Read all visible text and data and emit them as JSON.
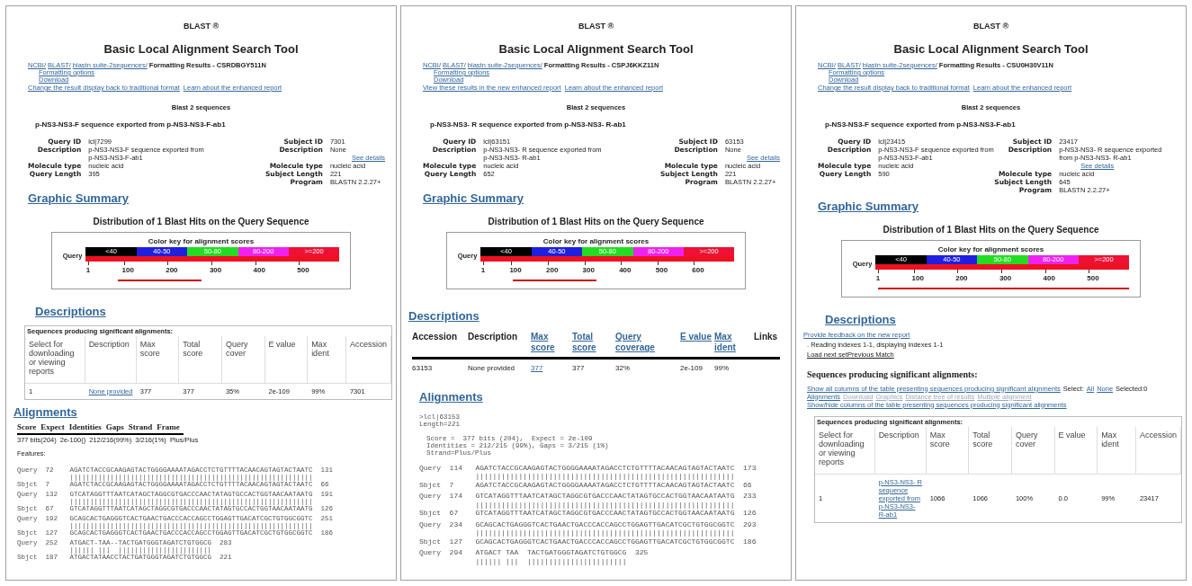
{
  "panels": [
    {
      "title": "BLAST ®",
      "subtitle": "Basic Local Alignment Search Tool",
      "breadcrumb": [
        "NCBI/",
        "BLAST/",
        "blastn suite-2sequences/"
      ],
      "results_label": "Formatting Results - CSRDBGY511N",
      "options": [
        "Formatting options",
        "Download"
      ],
      "report_links": [
        "Change the result display back to traditional format",
        "Learn about the enhanced report"
      ],
      "program_heading": "Blast 2 sequences",
      "query_title": "p-NS3-NS3-F sequence exported from p-NS3-NS3-F-ab1",
      "query_fields": [
        {
          "kind": "field",
          "label": "Query ID",
          "value": "lcl|7299"
        },
        {
          "kind": "field",
          "label": "Description",
          "value": "p-NS3-NS3-F sequence exported from p-NS3-NS3-F-ab1"
        },
        {
          "kind": "field",
          "label": "Molecule type",
          "value": "nucleic acid"
        },
        {
          "kind": "field",
          "label": "Query Length",
          "value": "395"
        }
      ],
      "subject_fields": [
        {
          "kind": "field",
          "label": "Subject ID",
          "value": "7301"
        },
        {
          "kind": "field",
          "label": "Description",
          "value": "None"
        },
        {
          "kind": "link",
          "value": "See details"
        },
        {
          "kind": "field",
          "label": "Molecule type",
          "value": "nucleic acid"
        },
        {
          "kind": "field",
          "label": "Subject Length",
          "value": "221"
        },
        {
          "kind": "field",
          "label": "Program",
          "value": "BLASTN 2.2.27+"
        }
      ],
      "graphic": {
        "heading": "Graphic Summary",
        "title": "Distribution of 1 Blast Hits on the Query Sequence",
        "key_title": "Color key for alignment scores",
        "query_label": "Query",
        "hit_full": false,
        "key": [
          {
            "label": "<40",
            "color": "#000000"
          },
          {
            "label": "40-50",
            "color": "#1f1fe0"
          },
          {
            "label": "50-80",
            "color": "#22dd22"
          },
          {
            "label": "80-200",
            "color": "#ee22ee"
          },
          {
            "label": ">=200",
            "color": "#ee1133"
          }
        ],
        "ticks": [
          "1",
          "100",
          "200",
          "300",
          "400",
          "500"
        ]
      },
      "descriptions": {
        "kind": "grid_table",
        "heading": "Descriptions",
        "caption": "Sequences producing significant alignments:",
        "columns": [
          "Select for downloading or viewing reports",
          "Description",
          "Max score",
          "Total score",
          "Query cover",
          "E value",
          "Max ident",
          "Accession"
        ],
        "rows": [
          [
            {
              "text": "1",
              "link": false
            },
            {
              "text": "None provided",
              "link": true
            },
            {
              "text": "377",
              "link": false
            },
            {
              "text": "377",
              "link": false
            },
            {
              "text": "35%",
              "link": false
            },
            {
              "text": "2e-109",
              "link": false
            },
            {
              "text": "99%",
              "link": false
            },
            {
              "text": "7301",
              "link": false
            }
          ]
        ]
      },
      "alignments": {
        "kind": "summary",
        "heading": "Alignments",
        "columns": [
          "Score",
          "Expect",
          "Identities",
          "Gaps",
          "Strand",
          "Frame"
        ],
        "values": [
          "377 bits(204)",
          "2e-100()",
          "212/216(99%)",
          "3/216(1%)",
          "Plus/Plus"
        ],
        "features": "Features:",
        "lines": [
          {
            "kind": "seq",
            "label": "Query",
            "start": "72",
            "seq": "AGATCTACCGCAAGAGTACTGGGGAAAATAGACCTCTGTTTTACAACAGTAGTACTAATC",
            "end": "131"
          },
          {
            "kind": "match",
            "seq": "||||||||||||||||||||||||||||||||||||||||||||||||||||||||||||"
          },
          {
            "kind": "seq",
            "label": "Sbjct",
            "start": "7",
            "seq": "AGATCTACCGCAAGAGTACTGGGGAAAATAGACCTCTGTTTTACAACAGTAGTACTAATC",
            "end": "66"
          },
          {
            "kind": "seq",
            "label": "Query",
            "start": "132",
            "seq": "GTCATAGGTTTAATCATAGCTAGGCGTGACCCAACTATAGTGCCACTGGTAACAATAATG",
            "end": "191"
          },
          {
            "kind": "match",
            "seq": "||||||||||||||||||||||||||||||||||||||||||||||||||||||||||||"
          },
          {
            "kind": "seq",
            "label": "Sbjct",
            "start": "67",
            "seq": "GTCATAGGTTTAATCATAGCTAGGCGTGACCCAACTATAGTGCCACTGGTAACAATAATG",
            "end": "126"
          },
          {
            "kind": "seq",
            "label": "Query",
            "start": "192",
            "seq": "GCAGCACTGAGGGTCACTGAACTGACCCACCAGCCTGGAGTTGACATCGCTGTGGCGGTC",
            "end": "251"
          },
          {
            "kind": "match",
            "seq": "||||||||||||||||||||||||||||||||||||||||||||||||||||||||||||"
          },
          {
            "kind": "seq",
            "label": "Sbjct",
            "start": "127",
            "seq": "GCAGCACTGAGGGTCACTGAACTGACCCACCAGCCTGGAGTTGACATCGCTGTGGCGGTC",
            "end": "186"
          },
          {
            "kind": "seq",
            "label": "Query",
            "start": "252",
            "seq": "ATGACT-TAA--TACTGATGGGTAGATCTGTGGCG",
            "end": "283"
          },
          {
            "kind": "match",
            "seq": "|||||| |||  |||||||||||||||||||||||"
          },
          {
            "kind": "seq",
            "label": "Sbjct",
            "start": "187",
            "seq": "ATGACTATAACCTACTGATGGGTAGATCTGTGGCG",
            "end": "221"
          }
        ]
      }
    },
    {
      "title": "BLAST ®",
      "subtitle": "Basic Local Alignment Search Tool",
      "breadcrumb": [
        "NCBI/",
        "BLAST/",
        "blastn suite-2sequences/"
      ],
      "results_label": "Formatting Results - CSPJ6KKZ11N",
      "options": [
        "Formatting options",
        "Download"
      ],
      "report_links": [
        "View these results in the new enhanced report",
        "Learn about the enhanced report"
      ],
      "program_heading": "Blast 2 sequences",
      "query_title": "p-NS3-NS3- R sequence exported from p-NS3-NS3- R-ab1",
      "query_fields": [
        {
          "kind": "field",
          "label": "Query ID",
          "value": "lcl|63151"
        },
        {
          "kind": "field",
          "label": "Description",
          "value": "p-NS3-NS3- R sequence exported from p-NS3-NS3- R-ab1"
        },
        {
          "kind": "field",
          "label": "Molecule type",
          "value": "nucleic acid"
        },
        {
          "kind": "field",
          "label": "Query Length",
          "value": "652"
        }
      ],
      "subject_fields": [
        {
          "kind": "field",
          "label": "Subject ID",
          "value": "63153"
        },
        {
          "kind": "field",
          "label": "Description",
          "value": "None"
        },
        {
          "kind": "link",
          "value": "See details"
        },
        {
          "kind": "field",
          "label": "Molecule type",
          "value": "nucleic acid"
        },
        {
          "kind": "field",
          "label": "Subject Length",
          "value": "221"
        },
        {
          "kind": "field",
          "label": "Program",
          "value": "BLASTN 2.2.27+"
        }
      ],
      "graphic": {
        "heading": "Graphic Summary",
        "title": "Distribution of 1 Blast Hits on the Query Sequence",
        "key_title": "Color key for alignment scores",
        "query_label": "Query",
        "hit_full": false,
        "key": [
          {
            "label": "<40",
            "color": "#000000"
          },
          {
            "label": "40-50",
            "color": "#1f1fe0"
          },
          {
            "label": "50-80",
            "color": "#22dd22"
          },
          {
            "label": "80-200",
            "color": "#ee22ee"
          },
          {
            "label": ">=200",
            "color": "#ee1133"
          }
        ],
        "ticks": [
          "1",
          "100",
          "200",
          "300",
          "400",
          "500",
          "600"
        ]
      },
      "descriptions": {
        "kind": "plain_table",
        "heading": "Descriptions",
        "columns": [
          {
            "text": "Accession",
            "link": false
          },
          {
            "text": "Description",
            "link": false
          },
          {
            "text": "Max score",
            "link": true
          },
          {
            "text": "Total score",
            "link": true
          },
          {
            "text": "Query coverage",
            "link": true
          },
          {
            "text": "E value",
            "link": true
          },
          {
            "text": "Max ident",
            "link": true
          },
          {
            "text": "Links",
            "link": false
          }
        ],
        "rows": [
          [
            {
              "text": "63153",
              "link": false
            },
            {
              "text": "None provided",
              "link": false
            },
            {
              "text": "377",
              "link": true
            },
            {
              "text": "377",
              "link": false
            },
            {
              "text": "32%",
              "link": false
            },
            {
              "text": "2e-109",
              "link": false
            },
            {
              "text": "99%",
              "link": false
            }
          ]
        ]
      },
      "alignments": {
        "kind": "text",
        "heading": "Alignments",
        "header_lines": [
          ">lcl|63153",
          "Length=221"
        ],
        "stats_lines": [
          "Score =  377 bits (204),  Expect = 2e-109",
          "Identities = 212/215 (99%), Gaps = 3/215 (1%)",
          "Strand=Plus/Plus"
        ],
        "lines": [
          {
            "kind": "seq",
            "label": "Query",
            "start": "114",
            "seq": "AGATCTACCGCAAGAGTACTGGGGAAAATAGACCTCTGTTTTACAACAGTAGTACTAATC",
            "end": "173"
          },
          {
            "kind": "match",
            "seq": "||||||||||||||||||||||||||||||||||||||||||||||||||||||||||||"
          },
          {
            "kind": "seq",
            "label": "Sbjct",
            "start": "7",
            "seq": "AGATCTACCGCAAGAGTACTGGGGAAAATAGACCTCTGTTTTACAACAGTAGTACTAATC",
            "end": "66"
          },
          {
            "kind": "seq",
            "label": "Query",
            "start": "174",
            "seq": "GTCATAGGTTTAATCATAGCTAGGCGTGACCCAACTATAGTGCCACTGGTAACAATAATG",
            "end": "233"
          },
          {
            "kind": "match",
            "seq": "||||||||||||||||||||||||||||||||||||||||||||||||||||||||||||"
          },
          {
            "kind": "seq",
            "label": "Sbjct",
            "start": "67",
            "seq": "GTCATAGGTTTAATCATAGCTAGGCGTGACCCAACTATAGTGCCACTGGTAACAATAATG",
            "end": "126"
          },
          {
            "kind": "seq",
            "label": "Query",
            "start": "234",
            "seq": "GCAGCACTGAGGGTCACTGAACTGACCCACCAGCCTGGAGTTGACATCGCTGTGGCGGTC",
            "end": "293"
          },
          {
            "kind": "match",
            "seq": "||||||||||||||||||||||||||||||||||||||||||||||||||||||||||||"
          },
          {
            "kind": "seq",
            "label": "Sbjct",
            "start": "127",
            "seq": "GCAGCACTGAGGGTCACTGAACTGACCCACCAGCCTGGAGTTGACATCGCTGTGGCGGTC",
            "end": "186"
          },
          {
            "kind": "seq",
            "label": "Query",
            "start": "294",
            "seq": "ATGACT TAA  TACTGATGGGTAGATCTGTGGCG",
            "end": "325"
          },
          {
            "kind": "match",
            "seq": "|||||| |||  |||||||||||||||||||||||"
          }
        ]
      }
    },
    {
      "title": "BLAST ®",
      "subtitle": "Basic Local Alignment Search Tool",
      "breadcrumb": [
        "NCBI/",
        "BLAST/",
        "blastn suite-2sequences/"
      ],
      "results_label": "Formatting Results - CSU0H30V11N",
      "options": [
        "Formatting options",
        "Download"
      ],
      "report_links": [
        "Change the result display back to traditional format",
        "Learn about the enhanced report"
      ],
      "program_heading": "Blast 2 sequences",
      "query_title": "p-NS3-NS3-F sequence exported from p-NS3-NS3-F-ab1",
      "query_fields": [
        {
          "kind": "field",
          "label": "Query ID",
          "value": "lcl|23415"
        },
        {
          "kind": "field",
          "label": "Description",
          "value": "p-NS3-NS3-F sequence exported from p-NS3-NS3-F-ab1"
        },
        {
          "kind": "field",
          "label": "Molecule type",
          "value": "nucleic acid"
        },
        {
          "kind": "field",
          "label": "Query Length",
          "value": "590"
        }
      ],
      "subject_fields": [
        {
          "kind": "field",
          "label": "Subject ID",
          "value": "23417"
        },
        {
          "kind": "field",
          "label": "Description",
          "value": "p-NS3-NS3- R sequence exported from p-NS3-NS3- R-ab1"
        },
        {
          "kind": "link",
          "value": "See details"
        },
        {
          "kind": "field",
          "label": "Molecule type",
          "value": "nucleic acid"
        },
        {
          "kind": "field",
          "label": "Subject Length",
          "value": "645"
        },
        {
          "kind": "field",
          "label": "Program",
          "value": "BLASTN 2.2.27+"
        }
      ],
      "graphic": {
        "heading": "Graphic Summary",
        "title": "Distribution of 1 Blast Hits on the Query Sequence",
        "key_title": "Color key for alignment scores",
        "query_label": "Query",
        "hit_full": true,
        "key": [
          {
            "label": "<40",
            "color": "#000000"
          },
          {
            "label": "40-50",
            "color": "#1f1fe0"
          },
          {
            "label": "50-80",
            "color": "#22dd22"
          },
          {
            "label": "80-200",
            "color": "#ee22ee"
          },
          {
            "label": ">=200",
            "color": "#ee1133"
          }
        ],
        "ticks": [
          "1",
          "100",
          "200",
          "300",
          "400",
          "500"
        ]
      },
      "descriptions": {
        "kind": "grid_table",
        "heading": "Descriptions",
        "feedback": "Provide feedback on the new report",
        "reading": ". Reading indexes 1-1, displaying indexes 1-1",
        "nav": "Load next setPrevious Match",
        "subheading": "Sequences producing significant alignments:",
        "tools": [
          {
            "text": "Show all columns of the table presenting sequences producing significant alignments",
            "kind": "link",
            "disabled": false
          },
          {
            "text": "Select:",
            "kind": "text",
            "disabled": false
          },
          {
            "text": "All",
            "kind": "link",
            "disabled": false
          },
          {
            "text": "None",
            "kind": "link",
            "disabled": false
          },
          {
            "text": "Selected:0",
            "kind": "text",
            "disabled": false
          },
          {
            "text": "Alignments",
            "kind": "link",
            "disabled": false
          },
          {
            "text": "Download",
            "kind": "link",
            "disabled": true
          },
          {
            "text": "Graphics",
            "kind": "link",
            "disabled": true
          },
          {
            "text": "Distance tree of results",
            "kind": "link",
            "disabled": true
          },
          {
            "text": "Multiple alignment",
            "kind": "link",
            "disabled": true
          },
          {
            "text": "Show/hide columns of the table presenting sequences producing significant alignments",
            "kind": "link",
            "disabled": false
          }
        ],
        "caption": "Sequences producing significant alignments:",
        "columns": [
          "Select for downloading or viewing reports",
          "Description",
          "Max score",
          "Total score",
          "Query cover",
          "E value",
          "Max ident",
          "Accession"
        ],
        "rows": [
          [
            {
              "text": "1",
              "link": false
            },
            {
              "text": "p-NS3-NS3- R sequence exported from p-NS3-NS3- R-ab1",
              "link": true
            },
            {
              "text": "1066",
              "link": false
            },
            {
              "text": "1066",
              "link": false
            },
            {
              "text": "100%",
              "link": false
            },
            {
              "text": "0.0",
              "link": false
            },
            {
              "text": "99%",
              "link": false
            },
            {
              "text": "23417",
              "link": false
            }
          ]
        ]
      }
    }
  ]
}
